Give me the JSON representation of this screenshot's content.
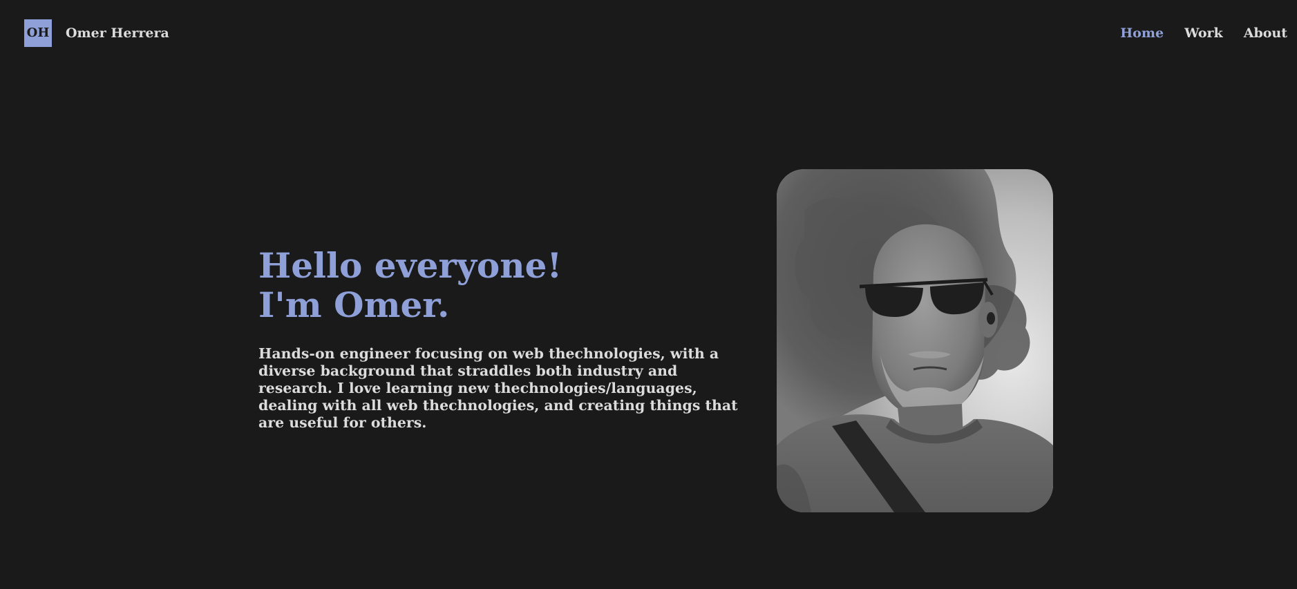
{
  "header": {
    "logo_text": "OH",
    "site_name": "Omer Herrera",
    "nav": [
      {
        "label": "Home",
        "active": true
      },
      {
        "label": "Work",
        "active": false
      },
      {
        "label": "About",
        "active": false
      }
    ]
  },
  "hero": {
    "title_line1": "Hello everyone!",
    "title_line2": "I'm Omer.",
    "description": "Hands-on engineer focusing on web thechnologies, with a diverse background that straddles both industry and research. I love learning new thechnologies/languages, dealing with all web thechnologies, and creating things that are useful for others."
  },
  "colors": {
    "background": "#1a1a1a",
    "accent": "#8fa0d9",
    "text": "#dcdcdc"
  }
}
